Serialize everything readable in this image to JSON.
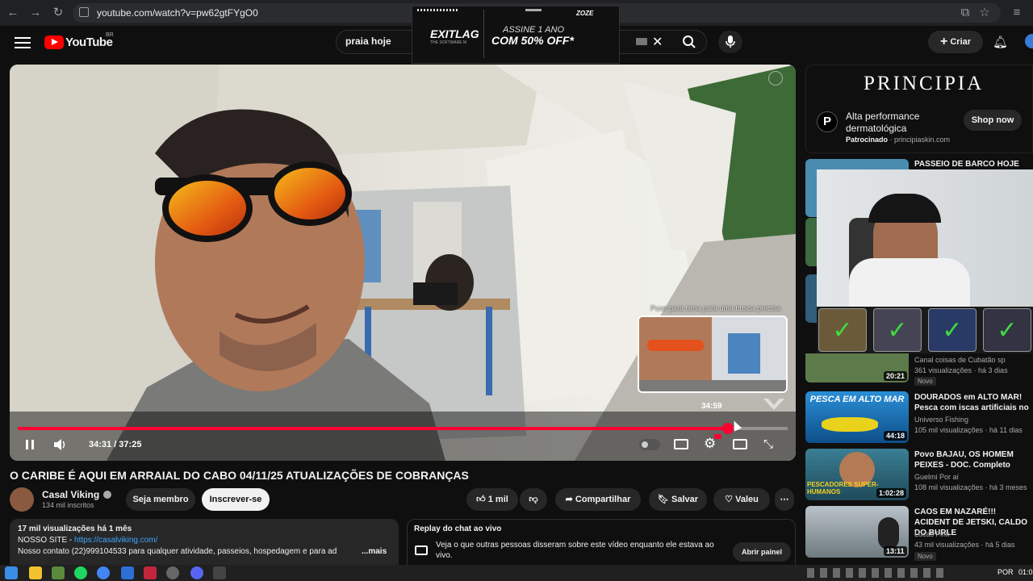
{
  "browser": {
    "url": "youtube.com/watch?v=pw62gtFYgO0"
  },
  "top_ad": {
    "brand": "EXITLAG",
    "tagline": "THE SOFTWARE M",
    "line1": "ASSINE 1 ANO",
    "line2": "COM 50% OFF*",
    "corner": "ZOZE"
  },
  "youtube": {
    "logo": "YouTube",
    "region": "BR",
    "search_value": "praia hoje",
    "create_label": "Criar"
  },
  "player": {
    "time_display": "34:31 / 37:25",
    "hover_time": "34:59",
    "progress_fraction": 0.9224,
    "overlay_hint": "Puxe para cima para uma busca precisa"
  },
  "video": {
    "title": "O CARIBE É AQUI EM ARRAIAL DO CABO 04/11/25 ATUALIZAÇÕES DE COBRANÇAS",
    "channel": "Casal Viking",
    "subscribers": "134 mil inscritos",
    "member_label": "Seja membro",
    "subscribe_label": "Inscrever-se",
    "likes": "1 mil",
    "share_label": "Compartilhar",
    "save_label": "Salvar",
    "thanks_label": "Valeu"
  },
  "description": {
    "stats": "17 mil visualizações  há 1 mês",
    "site_prefix": "NOSSO SITE - ",
    "site_link": "https://casalviking.com/",
    "contact": "Nosso contato (22)999104533 para qualquer atividade, passeios, hospedagem e para ad",
    "more": "...mais"
  },
  "chat_replay": {
    "title": "Replay do chat ao vivo",
    "text": "Veja o que outras pessoas disseram sobre este vídeo enquanto ele estava ao vivo.",
    "button": "Abrir painel"
  },
  "sidebar_ad": {
    "brand": "PRINCIPIA",
    "headline": "Alta performance dermatológica",
    "sponsored": "Patrocinado",
    "domain": "principiaskin.com",
    "button": "Shop now"
  },
  "related": [
    {
      "title": "PASSEIO DE BARCO HOJE",
      "channel": "",
      "meta": "",
      "duration": "",
      "badge": ""
    },
    {
      "title": "",
      "channel": "Canal coisas de Cubatão sp",
      "meta": "361 visualizações · há 3 dias",
      "duration": "20:21",
      "badge": "Novo"
    },
    {
      "title": "DOURADOS em ALTO MAR! Pesca com iscas artificiais no",
      "channel": "Universo Fishing",
      "meta": "105 mil visualizações · há 11 dias",
      "duration": "44:18",
      "badge": "",
      "thumb_text": "PESCA EM ALTO MAR"
    },
    {
      "title": "Povo BAJAU, OS HOMEM PEIXES - DOC. Completo",
      "channel": "Guelmi Por aí",
      "meta": "108 mil visualizações · há 3 meses",
      "duration": "1:02:28",
      "badge": "",
      "thumb_text": "PESCADORES SUPER-HUMANOS"
    },
    {
      "title": "CAOS EM NAZARÉ!!! ACIDENT DE JETSKI, CALDO DO BURLE",
      "channel": "Lucas Fink",
      "meta": "43 mil visualizações · há 5 dias",
      "duration": "13:11",
      "badge": "Novo"
    }
  ],
  "taskbar": {
    "lang": "POR",
    "clock": "01:0"
  },
  "colors": {
    "accent_red": "#ff0033",
    "background": "#0f0f0f",
    "link": "#3ea6ff"
  }
}
